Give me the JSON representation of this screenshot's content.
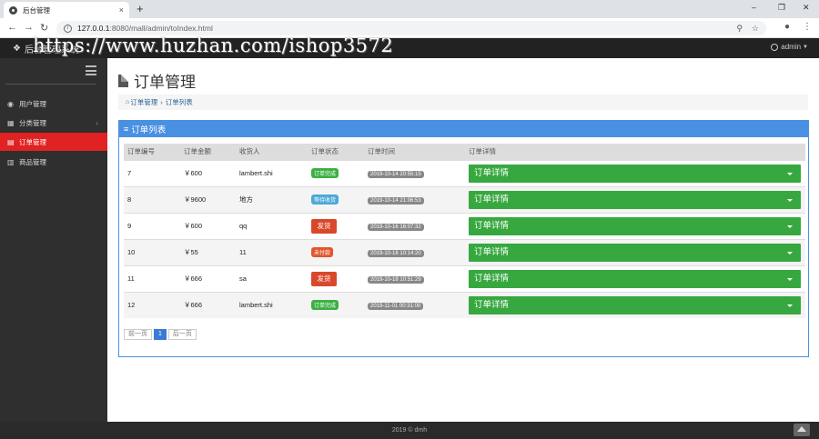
{
  "browser": {
    "tab_title": "后台管理",
    "tab_close": "×",
    "new_tab": "+",
    "url_host": "127.0.0.1",
    "url_rest": ":8080/mall/admin/toIndex.html",
    "win_min": "–",
    "win_max": "❐",
    "win_close": "✕"
  },
  "header": {
    "brand": "后台管理系统",
    "watermark": "https://www.huzhan.com/ishop3572",
    "admin": "admin"
  },
  "sidebar": {
    "items": [
      {
        "label": "用户管理"
      },
      {
        "label": "分类管理"
      },
      {
        "label": "订单管理"
      },
      {
        "label": "商品管理"
      }
    ]
  },
  "main": {
    "title": "订单管理",
    "breadcrumb": {
      "parent": "订单管理",
      "current": "订单列表"
    },
    "panel_title": "订单列表",
    "columns": [
      "订单编号",
      "订单金额",
      "收货人",
      "订单状态",
      "订单时间",
      "订单详情"
    ],
    "orders": [
      {
        "id": "7",
        "amount": "￥600",
        "receiver": "lambert.shi",
        "status": "订单完成",
        "time": "2019-10-14 20:55:15",
        "detail": "订单详情"
      },
      {
        "id": "8",
        "amount": "￥9600",
        "receiver": "地方",
        "status": "等待收货",
        "time": "2019-10-14 21:06:53",
        "detail": "订单详情"
      },
      {
        "id": "9",
        "amount": "￥600",
        "receiver": "qq",
        "status": "发货",
        "time": "2019-10-16 16:07:32",
        "detail": "订单详情"
      },
      {
        "id": "10",
        "amount": "￥55",
        "receiver": "11",
        "status": "未付款",
        "time": "2019-10-18 10:14:20",
        "detail": "订单详情"
      },
      {
        "id": "11",
        "amount": "￥666",
        "receiver": "sa",
        "status": "发货",
        "time": "2019-10-18 10:51:29",
        "detail": "订单详情"
      },
      {
        "id": "12",
        "amount": "￥666",
        "receiver": "lambert.shi",
        "status": "订单完成",
        "time": "2019-11-01 00:31:00",
        "detail": "订单详情"
      }
    ],
    "pager": {
      "prev": "前一页",
      "current": "1",
      "next": "后一页"
    }
  },
  "footer": {
    "text": "2019 © dmh"
  }
}
